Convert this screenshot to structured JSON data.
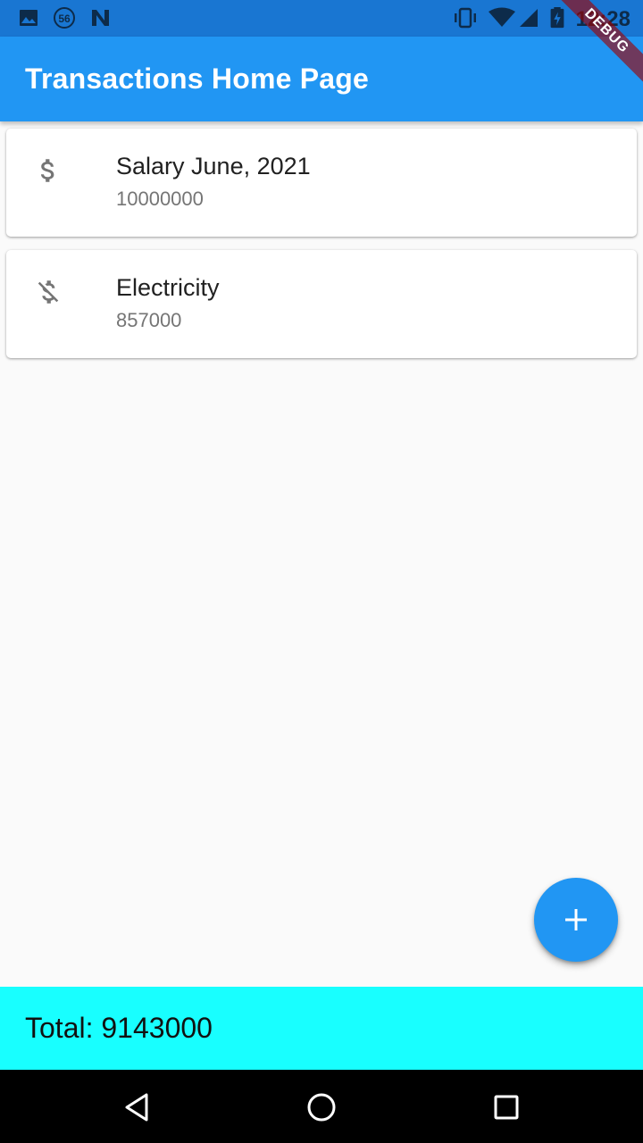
{
  "status_bar": {
    "time": "12:28",
    "icons": [
      "image-icon",
      "notification-count-icon",
      "n-app-icon",
      "vibrate-icon",
      "wifi-icon",
      "signal-icon",
      "battery-charging-icon"
    ],
    "notification_count": "56",
    "color": "#1976d2"
  },
  "debug_banner": {
    "label": "DEBUG"
  },
  "app_bar": {
    "title": "Transactions Home Page",
    "color": "#2196f3"
  },
  "transactions": [
    {
      "icon": "dollar-icon",
      "title": "Salary June, 2021",
      "amount": "10000000"
    },
    {
      "icon": "money-off-icon",
      "title": "Electricity",
      "amount": "857000"
    }
  ],
  "fab": {
    "icon": "add-icon",
    "color": "#2196f3"
  },
  "total_bar": {
    "text": "Total: 9143000",
    "color": "#18ffff"
  },
  "nav_bar": {
    "buttons": [
      "back-icon",
      "home-icon",
      "recents-icon"
    ]
  }
}
